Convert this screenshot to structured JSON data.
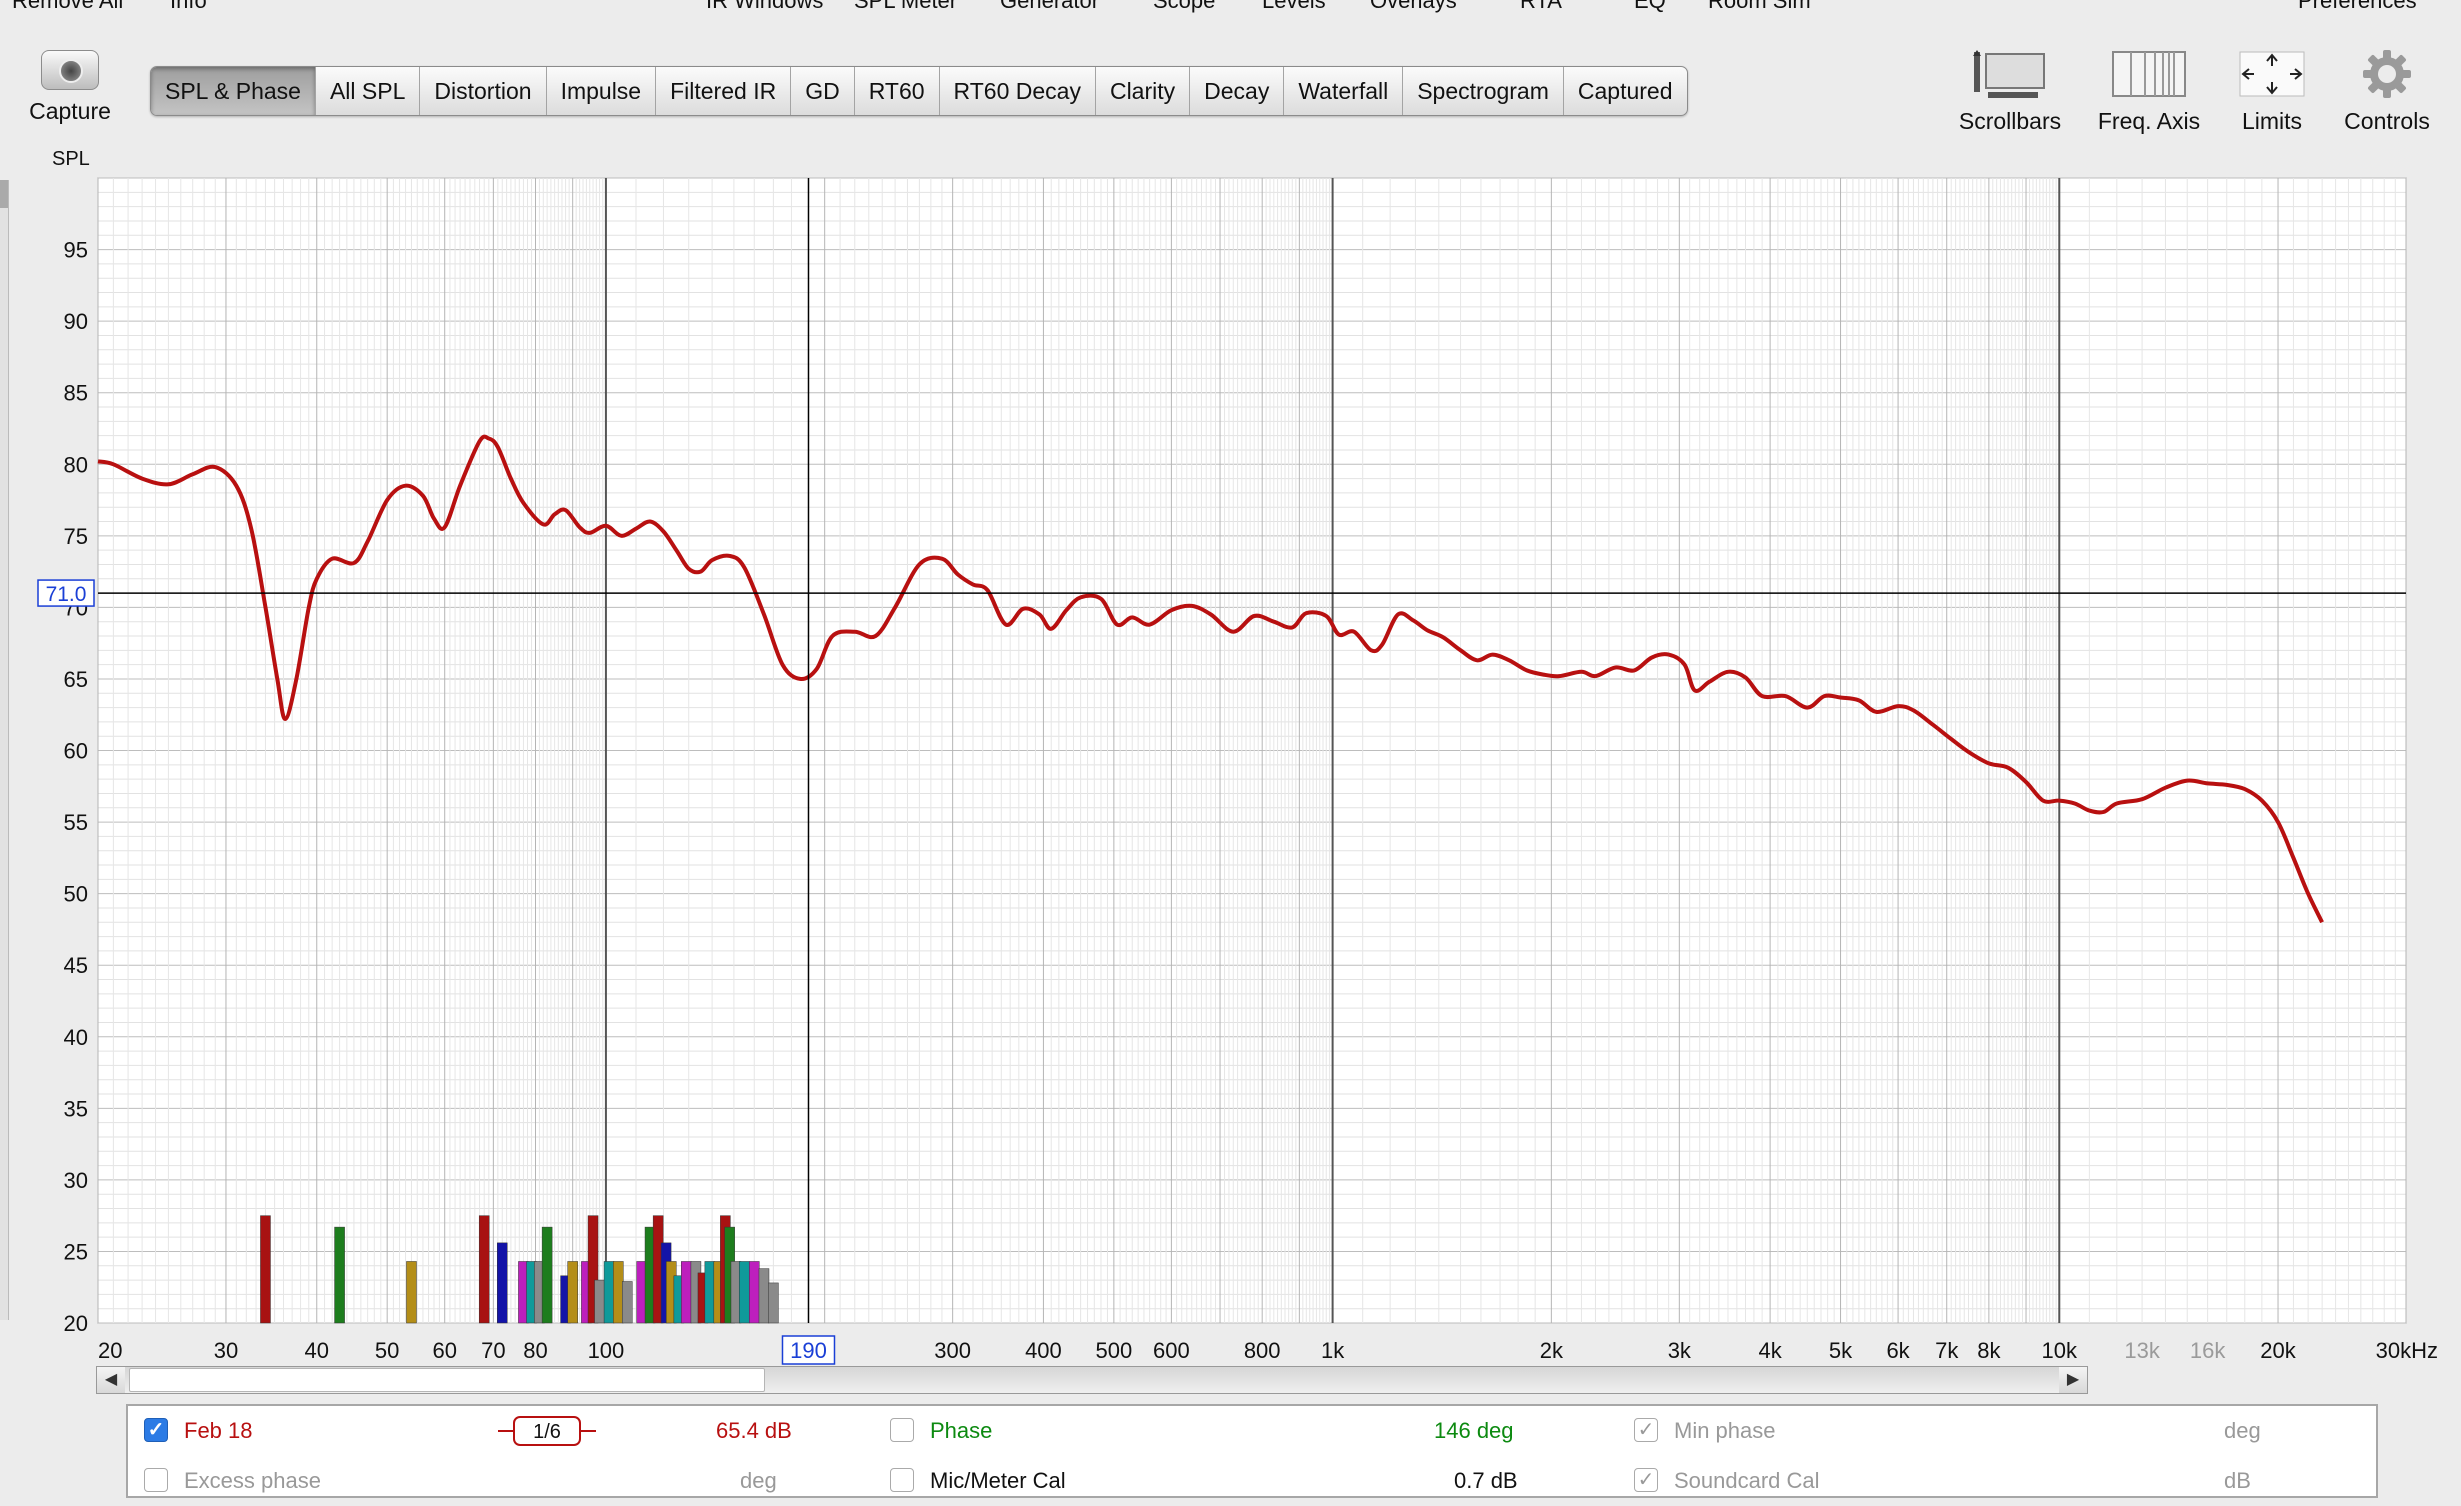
{
  "menu": [
    "Remove All",
    "Info",
    "IR Windows",
    "SPL Meter",
    "Generator",
    "Scope",
    "Levels",
    "Overlays",
    "RTA",
    "EQ",
    "Room Sim",
    "Preferences"
  ],
  "capture_label": "Capture",
  "tabs": [
    "SPL & Phase",
    "All SPL",
    "Distortion",
    "Impulse",
    "Filtered IR",
    "GD",
    "RT60",
    "RT60 Decay",
    "Clarity",
    "Decay",
    "Waterfall",
    "Spectrogram",
    "Captured"
  ],
  "active_tab": "SPL & Phase",
  "tools": {
    "scrollbars": "Scrollbars",
    "freq_axis": "Freq. Axis",
    "limits": "Limits",
    "controls": "Controls"
  },
  "colors": {
    "trace": "#b81010",
    "cursor": "#000000",
    "accent": "#1a3fd6",
    "phase": "#0c8a10"
  },
  "chart_data": {
    "type": "line",
    "ylabel": "SPL",
    "xscale": "log",
    "xlim": [
      20,
      30000
    ],
    "ylim": [
      20,
      100
    ],
    "y_ticks": [
      20,
      25,
      30,
      35,
      40,
      45,
      50,
      55,
      60,
      65,
      70,
      75,
      80,
      85,
      90,
      95
    ],
    "x_tick_labels": [
      {
        "f": 20,
        "t": "20"
      },
      {
        "f": 30,
        "t": "30"
      },
      {
        "f": 40,
        "t": "40"
      },
      {
        "f": 50,
        "t": "50"
      },
      {
        "f": 60,
        "t": "60"
      },
      {
        "f": 70,
        "t": "70"
      },
      {
        "f": 80,
        "t": "80"
      },
      {
        "f": 100,
        "t": "100"
      },
      {
        "f": 300,
        "t": "300"
      },
      {
        "f": 400,
        "t": "400"
      },
      {
        "f": 500,
        "t": "500"
      },
      {
        "f": 600,
        "t": "600"
      },
      {
        "f": 800,
        "t": "800"
      },
      {
        "f": 1000,
        "t": "1k"
      },
      {
        "f": 2000,
        "t": "2k"
      },
      {
        "f": 3000,
        "t": "3k"
      },
      {
        "f": 4000,
        "t": "4k"
      },
      {
        "f": 5000,
        "t": "5k"
      },
      {
        "f": 6000,
        "t": "6k"
      },
      {
        "f": 7000,
        "t": "7k"
      },
      {
        "f": 8000,
        "t": "8k"
      },
      {
        "f": 10000,
        "t": "10k"
      },
      {
        "f": 13000,
        "t": "13k",
        "dim": true
      },
      {
        "f": 16000,
        "t": "16k",
        "dim": true
      },
      {
        "f": 20000,
        "t": "20k"
      },
      {
        "f": 30000,
        "t": "30kHz"
      }
    ],
    "cursor": {
      "freq": 190,
      "freq_label": "190",
      "spl": 71.0,
      "spl_label": "71.0"
    },
    "series": [
      {
        "color": "#b81010",
        "points": [
          [
            20,
            80.2
          ],
          [
            21,
            80
          ],
          [
            23,
            79
          ],
          [
            25,
            78.6
          ],
          [
            27,
            79.3
          ],
          [
            29,
            79.8
          ],
          [
            31,
            78.5
          ],
          [
            32.5,
            75.5
          ],
          [
            34,
            70
          ],
          [
            35.3,
            65
          ],
          [
            36.2,
            62.2
          ],
          [
            37.5,
            65
          ],
          [
            39,
            70
          ],
          [
            40,
            72
          ],
          [
            42,
            73.4
          ],
          [
            45,
            73.1
          ],
          [
            47,
            74.6
          ],
          [
            50,
            77.5
          ],
          [
            53,
            78.5
          ],
          [
            56,
            77.8
          ],
          [
            58,
            76.2
          ],
          [
            60,
            75.6
          ],
          [
            63,
            78.5
          ],
          [
            67,
            81.6
          ],
          [
            69,
            81.8
          ],
          [
            71,
            81.2
          ],
          [
            74,
            79
          ],
          [
            77,
            77.3
          ],
          [
            82,
            75.8
          ],
          [
            85,
            76.5
          ],
          [
            88,
            76.8
          ],
          [
            92,
            75.6
          ],
          [
            95,
            75.2
          ],
          [
            100,
            75.7
          ],
          [
            105,
            75
          ],
          [
            110,
            75.5
          ],
          [
            115,
            76
          ],
          [
            120,
            75.3
          ],
          [
            125,
            74
          ],
          [
            130,
            72.7
          ],
          [
            135,
            72.5
          ],
          [
            140,
            73.3
          ],
          [
            148,
            73.6
          ],
          [
            155,
            72.8
          ],
          [
            165,
            69.5
          ],
          [
            175,
            66
          ],
          [
            185,
            65
          ],
          [
            195,
            65.7
          ],
          [
            205,
            68
          ],
          [
            220,
            68.3
          ],
          [
            235,
            68
          ],
          [
            250,
            70
          ],
          [
            270,
            73
          ],
          [
            290,
            73.4
          ],
          [
            305,
            72.3
          ],
          [
            320,
            71.6
          ],
          [
            335,
            71.2
          ],
          [
            355,
            68.8
          ],
          [
            375,
            69.9
          ],
          [
            395,
            69.5
          ],
          [
            410,
            68.5
          ],
          [
            430,
            69.8
          ],
          [
            450,
            70.7
          ],
          [
            480,
            70.6
          ],
          [
            505,
            68.8
          ],
          [
            530,
            69.3
          ],
          [
            560,
            68.8
          ],
          [
            600,
            69.8
          ],
          [
            640,
            70.1
          ],
          [
            680,
            69.5
          ],
          [
            730,
            68.3
          ],
          [
            780,
            69.4
          ],
          [
            830,
            69
          ],
          [
            880,
            68.6
          ],
          [
            920,
            69.6
          ],
          [
            980,
            69.4
          ],
          [
            1020,
            68.1
          ],
          [
            1070,
            68.3
          ],
          [
            1130,
            67
          ],
          [
            1170,
            67.4
          ],
          [
            1230,
            69.5
          ],
          [
            1290,
            69.1
          ],
          [
            1350,
            68.4
          ],
          [
            1420,
            67.9
          ],
          [
            1500,
            67
          ],
          [
            1580,
            66.3
          ],
          [
            1660,
            66.7
          ],
          [
            1750,
            66.3
          ],
          [
            1850,
            65.6
          ],
          [
            1950,
            65.3
          ],
          [
            2050,
            65.2
          ],
          [
            2200,
            65.5
          ],
          [
            2300,
            65.2
          ],
          [
            2450,
            65.8
          ],
          [
            2600,
            65.6
          ],
          [
            2750,
            66.5
          ],
          [
            2900,
            66.7
          ],
          [
            3050,
            66
          ],
          [
            3150,
            64.2
          ],
          [
            3300,
            64.8
          ],
          [
            3500,
            65.5
          ],
          [
            3700,
            65.1
          ],
          [
            3900,
            63.8
          ],
          [
            4200,
            63.8
          ],
          [
            4500,
            63
          ],
          [
            4750,
            63.8
          ],
          [
            5000,
            63.7
          ],
          [
            5300,
            63.5
          ],
          [
            5600,
            62.7
          ],
          [
            6000,
            63.1
          ],
          [
            6300,
            62.8
          ],
          [
            6700,
            61.8
          ],
          [
            7100,
            60.8
          ],
          [
            7500,
            59.9
          ],
          [
            8000,
            59.1
          ],
          [
            8500,
            58.8
          ],
          [
            9000,
            57.8
          ],
          [
            9500,
            56.5
          ],
          [
            10000,
            56.5
          ],
          [
            10500,
            56.3
          ],
          [
            11000,
            55.8
          ],
          [
            11500,
            55.7
          ],
          [
            12000,
            56.3
          ],
          [
            13000,
            56.6
          ],
          [
            14000,
            57.4
          ],
          [
            15000,
            57.9
          ],
          [
            16000,
            57.7
          ],
          [
            17000,
            57.6
          ],
          [
            18000,
            57.3
          ],
          [
            19000,
            56.5
          ],
          [
            20000,
            55
          ],
          [
            21000,
            52.5
          ],
          [
            22000,
            50
          ],
          [
            23000,
            48
          ]
        ]
      }
    ],
    "bars": {
      "colors": [
        "#a81212",
        "#1d7d1d",
        "#b48e18",
        "#1414a8",
        "#bd1fbd",
        "#0f9a9a",
        "#8a8a8a"
      ],
      "items": [
        [
          34,
          27.5,
          0
        ],
        [
          43,
          26.7,
          1
        ],
        [
          54,
          24.3,
          2
        ],
        [
          68,
          27.5,
          0
        ],
        [
          72,
          25.6,
          3
        ],
        [
          77,
          24.3,
          4
        ],
        [
          79,
          24.3,
          5
        ],
        [
          81,
          24.3,
          6
        ],
        [
          83,
          26.7,
          1
        ],
        [
          88,
          23.3,
          3
        ],
        [
          90,
          24.3,
          2
        ],
        [
          94,
          24.3,
          4
        ],
        [
          96,
          27.5,
          0
        ],
        [
          98,
          23,
          6
        ],
        [
          101,
          24.3,
          5
        ],
        [
          104,
          24.3,
          2
        ],
        [
          107,
          22.9,
          6
        ],
        [
          112,
          24.3,
          4
        ],
        [
          115,
          26.7,
          1
        ],
        [
          118,
          27.5,
          0
        ],
        [
          121,
          25.6,
          3
        ],
        [
          123,
          24.3,
          2
        ],
        [
          126,
          23.3,
          5
        ],
        [
          129,
          24.3,
          4
        ],
        [
          133,
          24.3,
          6
        ],
        [
          136,
          23.5,
          0
        ],
        [
          139,
          24.3,
          5
        ],
        [
          143,
          24.3,
          2
        ],
        [
          146,
          27.5,
          0
        ],
        [
          148,
          26.7,
          1
        ],
        [
          151,
          24.3,
          6
        ],
        [
          155,
          24.3,
          5
        ],
        [
          160,
          24.3,
          4
        ],
        [
          165,
          23.8,
          6
        ],
        [
          170,
          22.8,
          6
        ]
      ]
    }
  },
  "panel": {
    "trace_name": "Feb 18",
    "smoothing": "1/6",
    "spl_value": "65.4 dB",
    "phase_label": "Phase",
    "phase_value": "146 deg",
    "min_phase_label": "Min phase",
    "min_phase_unit": "deg",
    "excess_phase_label": "Excess phase",
    "excess_phase_unit": "deg",
    "mic_label": "Mic/Meter Cal",
    "mic_value": "0.7 dB",
    "soundcard_label": "Soundcard Cal",
    "soundcard_unit": "dB"
  }
}
